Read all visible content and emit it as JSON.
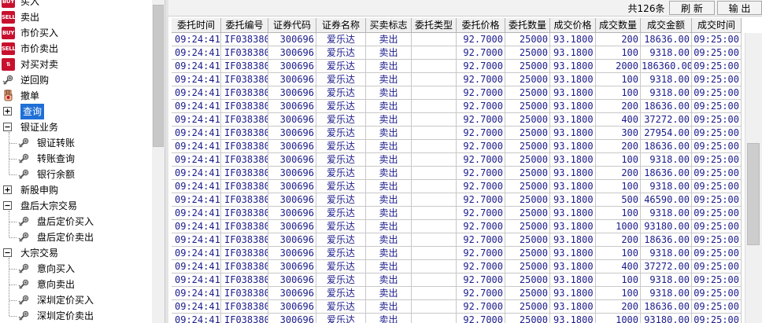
{
  "tree": {
    "items": [
      {
        "label": "买入",
        "icon": "buy-badge-icon",
        "badge": "BUY",
        "kind": "leaf0"
      },
      {
        "label": "卖出",
        "icon": "sell-badge-icon",
        "badge": "SELL",
        "kind": "leaf0"
      },
      {
        "label": "市价买入",
        "icon": "buy-badge-icon",
        "badge": "BUY",
        "kind": "leaf0"
      },
      {
        "label": "市价卖出",
        "icon": "sell-badge-icon",
        "badge": "SELL",
        "kind": "leaf0"
      },
      {
        "label": "对买对卖",
        "icon": "swap-badge-icon",
        "badge": "⇅",
        "kind": "leaf0"
      },
      {
        "label": "逆回购",
        "icon": "gear-hand-icon",
        "kind": "leaf0"
      },
      {
        "label": "撤单",
        "icon": "hand-stop-icon",
        "kind": "leaf0"
      },
      {
        "label": "查询",
        "icon": "plus-expand-icon",
        "kind": "folder-closed",
        "selected": true
      },
      {
        "label": "银证业务",
        "icon": "minus-collapse-icon",
        "kind": "folder-open"
      },
      {
        "label": "银证转账",
        "icon": "gear-hand-icon",
        "kind": "child"
      },
      {
        "label": "转账查询",
        "icon": "gear-hand-icon",
        "kind": "child"
      },
      {
        "label": "银行余额",
        "icon": "gear-hand-icon",
        "kind": "child"
      },
      {
        "label": "新股申购",
        "icon": "plus-expand-icon",
        "kind": "folder-closed"
      },
      {
        "label": "盘后大宗交易",
        "icon": "minus-collapse-icon",
        "kind": "folder-open"
      },
      {
        "label": "盘后定价买入",
        "icon": "gear-hand-icon",
        "kind": "child"
      },
      {
        "label": "盘后定价卖出",
        "icon": "gear-hand-icon",
        "kind": "child"
      },
      {
        "label": "大宗交易",
        "icon": "minus-collapse-icon",
        "kind": "folder-open"
      },
      {
        "label": "意向买入",
        "icon": "gear-hand-icon",
        "kind": "child"
      },
      {
        "label": "意向卖出",
        "icon": "gear-hand-icon",
        "kind": "child"
      },
      {
        "label": "深圳定价买入",
        "icon": "gear-hand-icon",
        "kind": "child"
      },
      {
        "label": "深圳定价卖出",
        "icon": "gear-hand-icon",
        "kind": "child"
      }
    ]
  },
  "toolbar": {
    "count_label": "共126条",
    "refresh_label": "刷 新",
    "export_label": "输 出"
  },
  "table": {
    "columns": [
      "委托时间",
      "委托编号",
      "证券代码",
      "证券名称",
      "买卖标志",
      "委托类型",
      "委托价格",
      "委托数量",
      "成交价格",
      "成交数量",
      "成交金额",
      "成交时间"
    ],
    "rows": [
      [
        "09:24:41",
        "IF038380",
        "300696",
        "爱乐达",
        "卖出",
        "",
        "92.7000",
        "25000",
        "93.1800",
        "200",
        "18636.00",
        "09:25:00"
      ],
      [
        "09:24:41",
        "IF038380",
        "300696",
        "爱乐达",
        "卖出",
        "",
        "92.7000",
        "25000",
        "93.1800",
        "100",
        "9318.00",
        "09:25:00"
      ],
      [
        "09:24:41",
        "IF038380",
        "300696",
        "爱乐达",
        "卖出",
        "",
        "92.7000",
        "25000",
        "93.1800",
        "2000",
        "186360.00",
        "09:25:00"
      ],
      [
        "09:24:41",
        "IF038380",
        "300696",
        "爱乐达",
        "卖出",
        "",
        "92.7000",
        "25000",
        "93.1800",
        "100",
        "9318.00",
        "09:25:00"
      ],
      [
        "09:24:41",
        "IF038380",
        "300696",
        "爱乐达",
        "卖出",
        "",
        "92.7000",
        "25000",
        "93.1800",
        "100",
        "9318.00",
        "09:25:00"
      ],
      [
        "09:24:41",
        "IF038380",
        "300696",
        "爱乐达",
        "卖出",
        "",
        "92.7000",
        "25000",
        "93.1800",
        "200",
        "18636.00",
        "09:25:00"
      ],
      [
        "09:24:41",
        "IF038380",
        "300696",
        "爱乐达",
        "卖出",
        "",
        "92.7000",
        "25000",
        "93.1800",
        "400",
        "37272.00",
        "09:25:00"
      ],
      [
        "09:24:41",
        "IF038380",
        "300696",
        "爱乐达",
        "卖出",
        "",
        "92.7000",
        "25000",
        "93.1800",
        "300",
        "27954.00",
        "09:25:00"
      ],
      [
        "09:24:41",
        "IF038380",
        "300696",
        "爱乐达",
        "卖出",
        "",
        "92.7000",
        "25000",
        "93.1800",
        "200",
        "18636.00",
        "09:25:00"
      ],
      [
        "09:24:41",
        "IF038380",
        "300696",
        "爱乐达",
        "卖出",
        "",
        "92.7000",
        "25000",
        "93.1800",
        "100",
        "9318.00",
        "09:25:00"
      ],
      [
        "09:24:41",
        "IF038380",
        "300696",
        "爱乐达",
        "卖出",
        "",
        "92.7000",
        "25000",
        "93.1800",
        "200",
        "18636.00",
        "09:25:00"
      ],
      [
        "09:24:41",
        "IF038380",
        "300696",
        "爱乐达",
        "卖出",
        "",
        "92.7000",
        "25000",
        "93.1800",
        "100",
        "9318.00",
        "09:25:00"
      ],
      [
        "09:24:41",
        "IF038380",
        "300696",
        "爱乐达",
        "卖出",
        "",
        "92.7000",
        "25000",
        "93.1800",
        "500",
        "46590.00",
        "09:25:00"
      ],
      [
        "09:24:41",
        "IF038380",
        "300696",
        "爱乐达",
        "卖出",
        "",
        "92.7000",
        "25000",
        "93.1800",
        "100",
        "9318.00",
        "09:25:00"
      ],
      [
        "09:24:41",
        "IF038380",
        "300696",
        "爱乐达",
        "卖出",
        "",
        "92.7000",
        "25000",
        "93.1800",
        "1000",
        "93180.00",
        "09:25:00"
      ],
      [
        "09:24:41",
        "IF038380",
        "300696",
        "爱乐达",
        "卖出",
        "",
        "92.7000",
        "25000",
        "93.1800",
        "200",
        "18636.00",
        "09:25:00"
      ],
      [
        "09:24:41",
        "IF038380",
        "300696",
        "爱乐达",
        "卖出",
        "",
        "92.7000",
        "25000",
        "93.1800",
        "100",
        "9318.00",
        "09:25:00"
      ],
      [
        "09:24:41",
        "IF038380",
        "300696",
        "爱乐达",
        "卖出",
        "",
        "92.7000",
        "25000",
        "93.1800",
        "400",
        "37272.00",
        "09:25:00"
      ],
      [
        "09:24:41",
        "IF038380",
        "300696",
        "爱乐达",
        "卖出",
        "",
        "92.7000",
        "25000",
        "93.1800",
        "100",
        "9318.00",
        "09:25:00"
      ],
      [
        "09:24:41",
        "IF038380",
        "300696",
        "爱乐达",
        "卖出",
        "",
        "92.7000",
        "25000",
        "93.1800",
        "100",
        "9318.00",
        "09:25:00"
      ],
      [
        "09:24:41",
        "IF038380",
        "300696",
        "爱乐达",
        "卖出",
        "",
        "92.7000",
        "25000",
        "93.1800",
        "200",
        "18636.00",
        "09:25:00"
      ],
      [
        "09:24:41",
        "IF038380",
        "300696",
        "爱乐达",
        "卖出",
        "",
        "92.7000",
        "25000",
        "93.1800",
        "1000",
        "93180.00",
        "09:25:00"
      ]
    ]
  },
  "colors": {
    "cell_text": "#1a1a8c",
    "selection": "#1f6fd6",
    "badge": "#c8102e"
  }
}
